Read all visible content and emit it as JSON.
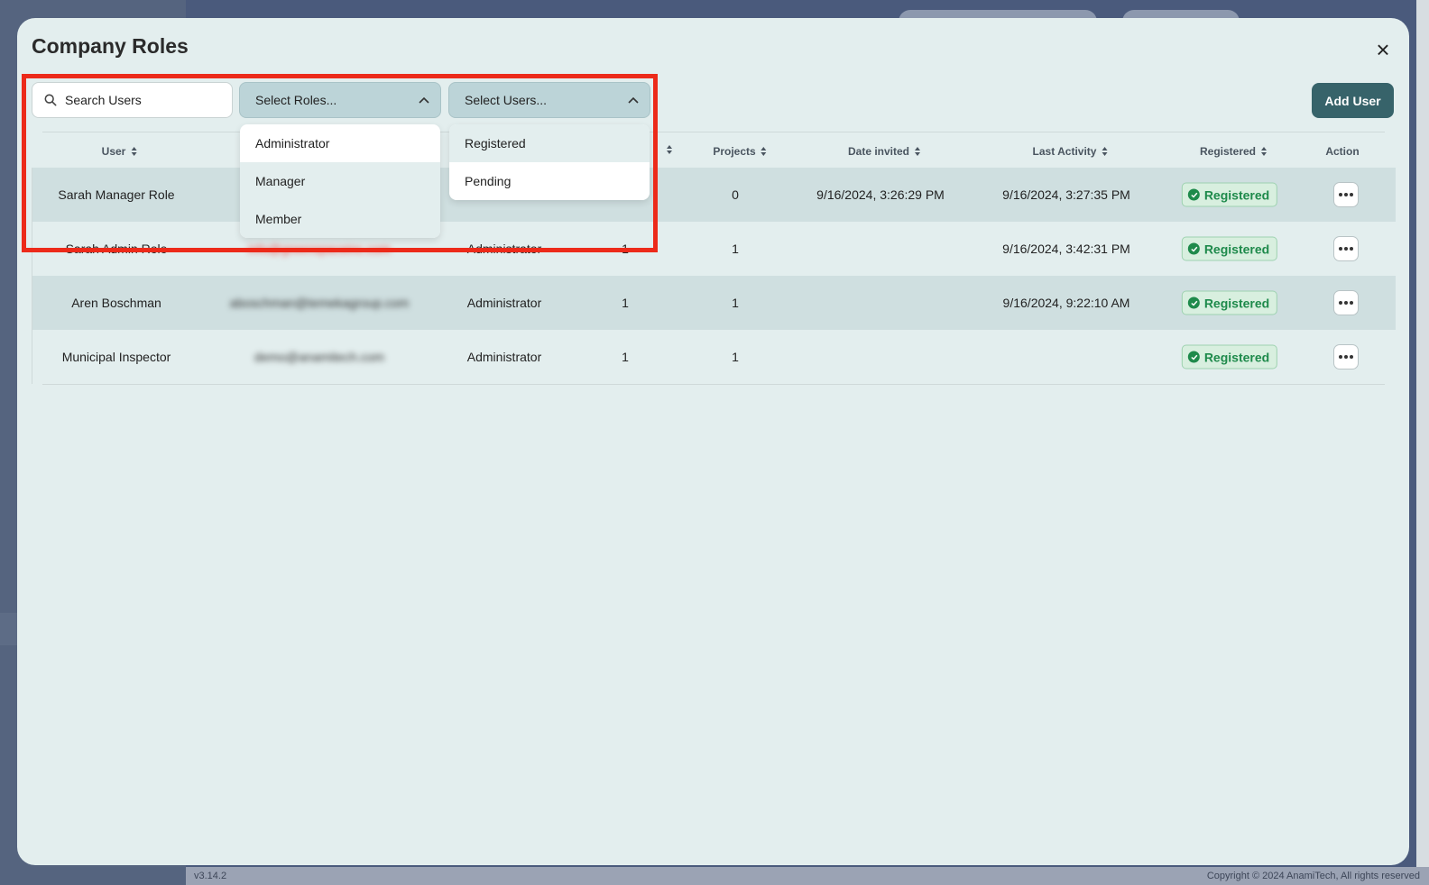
{
  "app": {
    "version": "v3.14.2",
    "copyright": "Copyright © 2024 AnamiTech, All rights reserved"
  },
  "modal": {
    "title": "Company Roles",
    "close_glyph": "×"
  },
  "toolbar": {
    "search_placeholder": "Search Users",
    "roles_select": {
      "label": "Select Roles...",
      "options": [
        "Administrator",
        "Manager",
        "Member"
      ]
    },
    "users_select": {
      "label": "Select Users...",
      "options": [
        "Registered",
        "Pending"
      ]
    },
    "add_user_label": "Add User"
  },
  "table": {
    "headers": [
      "User",
      "Projects",
      "Date invited",
      "Last Activity",
      "Registered",
      "Action"
    ],
    "rows": [
      {
        "user": "Sarah Manager Role",
        "email": "",
        "role": "",
        "count": "",
        "projects": "0",
        "date_invited": "9/16/2024, 3:26:29 PM",
        "last_activity": "9/16/2024, 3:27:35 PM",
        "status": "Registered"
      },
      {
        "user": "Sarah Admin Role",
        "email": "info@greenspaceinc.com",
        "role": "Administrator",
        "count": "1",
        "projects": "1",
        "date_invited": "",
        "last_activity": "9/16/2024, 3:42:31 PM",
        "status": "Registered"
      },
      {
        "user": "Aren Boschman",
        "email": "aboschman@temekagroup.com",
        "role": "Administrator",
        "count": "1",
        "projects": "1",
        "date_invited": "",
        "last_activity": "9/16/2024, 9:22:10 AM",
        "status": "Registered"
      },
      {
        "user": "Municipal Inspector",
        "email": "demo@anamitech.com",
        "role": "Administrator",
        "count": "1",
        "projects": "1",
        "date_invited": "",
        "last_activity": "",
        "status": "Registered"
      }
    ]
  },
  "colors": {
    "accent": "#37636a",
    "highlight": "#ec2a1a",
    "status_green": "#1e8a4b"
  }
}
